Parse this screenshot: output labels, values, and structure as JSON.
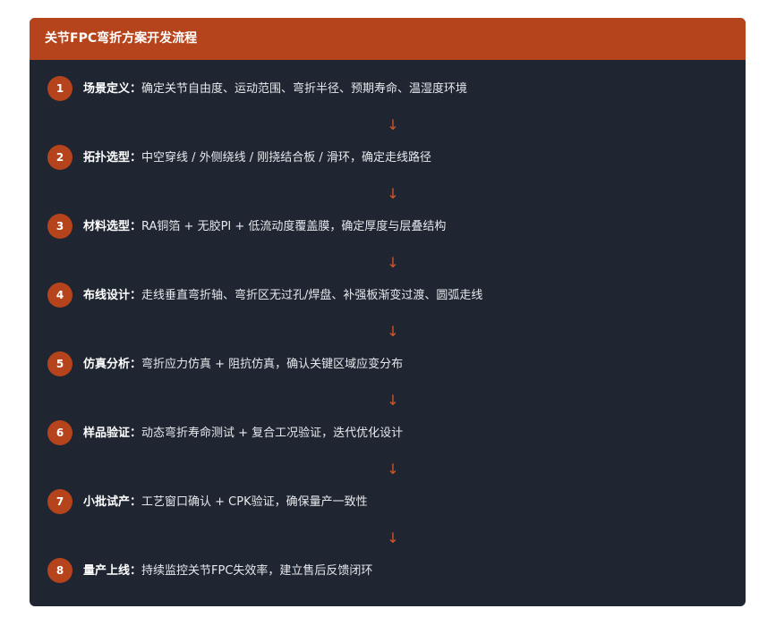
{
  "header": {
    "title": "关节FPC弯折方案开发流程"
  },
  "colors": {
    "accent": "#b5431c",
    "panel": "#1f2632",
    "arrow": "#d4542a"
  },
  "steps": [
    {
      "num": "1",
      "title": "场景定义：",
      "desc": "确定关节自由度、运动范围、弯折半径、预期寿命、温湿度环境"
    },
    {
      "num": "2",
      "title": "拓扑选型：",
      "desc": "中空穿线 / 外侧绕线 / 刚挠结合板 / 滑环，确定走线路径"
    },
    {
      "num": "3",
      "title": "材料选型：",
      "desc": "RA铜箔 + 无胶PI + 低流动度覆盖膜，确定厚度与层叠结构"
    },
    {
      "num": "4",
      "title": "布线设计：",
      "desc": "走线垂直弯折轴、弯折区无过孔/焊盘、补强板渐变过渡、圆弧走线"
    },
    {
      "num": "5",
      "title": "仿真分析：",
      "desc": "弯折应力仿真 + 阻抗仿真，确认关键区域应变分布"
    },
    {
      "num": "6",
      "title": "样品验证：",
      "desc": "动态弯折寿命测试 + 复合工况验证，迭代优化设计"
    },
    {
      "num": "7",
      "title": "小批试产：",
      "desc": "工艺窗口确认 + CPK验证，确保量产一致性"
    },
    {
      "num": "8",
      "title": "量产上线：",
      "desc": "持续监控关节FPC失效率，建立售后反馈闭环"
    }
  ],
  "arrows": [
    "↓",
    "↓",
    "↓",
    "↓",
    "↓",
    "↓",
    "↓"
  ]
}
